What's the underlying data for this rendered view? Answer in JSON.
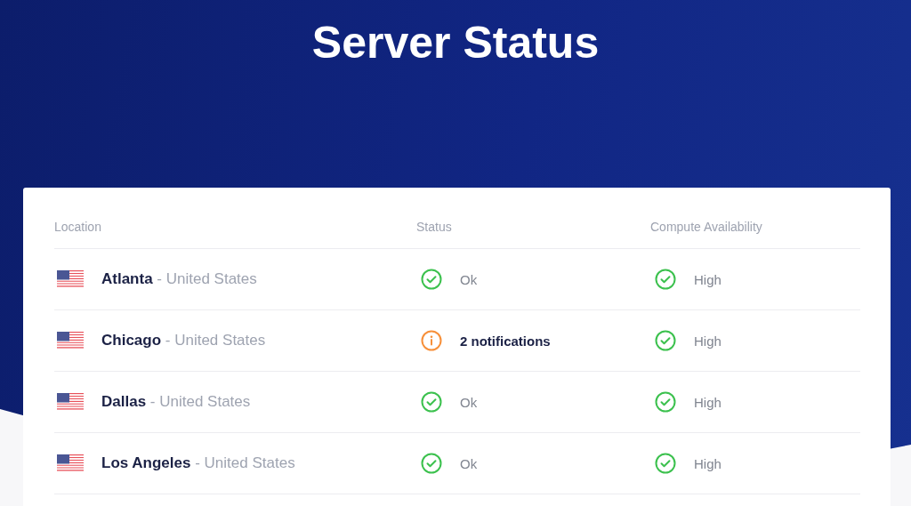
{
  "title": "Server Status",
  "table": {
    "columns": [
      "Location",
      "Status",
      "Compute Availability"
    ],
    "rows": [
      {
        "city": "Atlanta",
        "country": "- United States",
        "status": {
          "kind": "ok",
          "text": "Ok"
        },
        "compute": {
          "kind": "ok",
          "text": "High"
        }
      },
      {
        "city": "Chicago",
        "country": "- United States",
        "status": {
          "kind": "notice",
          "text": "2 notifications"
        },
        "compute": {
          "kind": "ok",
          "text": "High"
        }
      },
      {
        "city": "Dallas",
        "country": "- United States",
        "status": {
          "kind": "ok",
          "text": "Ok"
        },
        "compute": {
          "kind": "ok",
          "text": "High"
        }
      },
      {
        "city": "Los Angeles",
        "country": "- United States",
        "status": {
          "kind": "ok",
          "text": "Ok"
        },
        "compute": {
          "kind": "ok",
          "text": "High"
        }
      }
    ]
  }
}
